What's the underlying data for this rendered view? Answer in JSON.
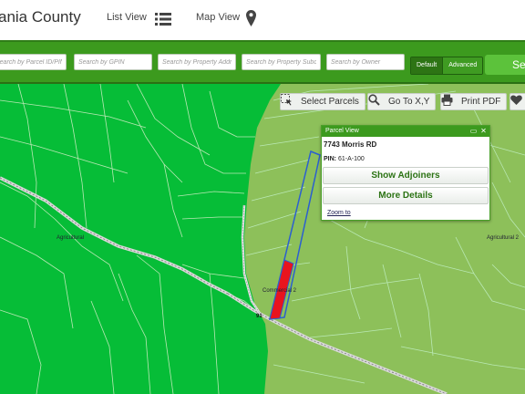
{
  "header": {
    "title": "ania County",
    "list_view_label": "List View",
    "map_view_label": "Map View",
    "list_icon": "list-icon",
    "map_icon": "map-pin-icon"
  },
  "search": {
    "placeholders": [
      "Search by Parcel ID/PIN",
      "Search by GPIN",
      "Search by Property Address",
      "Search by Property Subdivision",
      "Search by Owner"
    ],
    "mode_default": "Default",
    "mode_advanced": "Advanced",
    "search_button": "Se"
  },
  "map": {
    "toolbar": {
      "select_parcels": "Select Parcels",
      "goto_xy": "Go To X,Y",
      "print_pdf": "Print PDF"
    },
    "labels": {
      "agricultural_left": "Agricultural",
      "agricultural_right": "Agricultural 2",
      "commercial": "Commercial 2"
    },
    "colors": {
      "zone_dark": "#06bd37",
      "zone_light": "#8dc05a",
      "parcel_outline": "#2b5fd0",
      "selected_parcel": "#e8141e"
    }
  },
  "popup": {
    "title": "Parcel View",
    "address": "7743 Morris RD",
    "pin_label": "PIN:",
    "pin_value": "61-A-100",
    "show_adjoiners": "Show Adjoiners",
    "more_details": "More Details",
    "zoom_to": "Zoom to"
  }
}
